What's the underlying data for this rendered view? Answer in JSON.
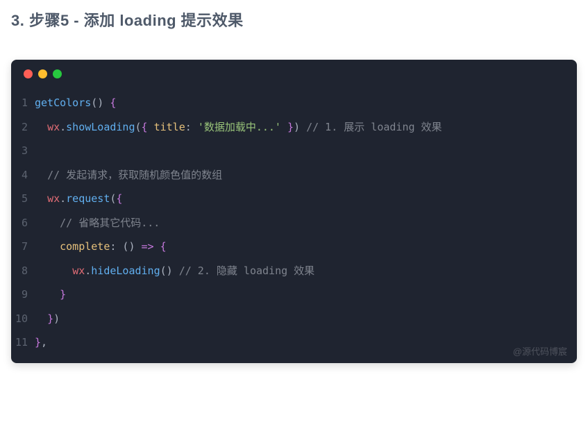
{
  "heading": "3. 步骤5 - 添加 loading 提示效果",
  "traffic_lights": [
    "red",
    "yellow",
    "green"
  ],
  "watermark": "@源代码博宸",
  "code": {
    "lines": [
      {
        "n": "1",
        "t": [
          {
            "c": "tok-fn",
            "s": "getColors"
          },
          {
            "c": "tok-punct",
            "s": "() "
          },
          {
            "c": "tok-brace",
            "s": "{"
          }
        ]
      },
      {
        "n": "2",
        "t": [
          {
            "c": "tok-plain",
            "s": "  "
          },
          {
            "c": "tok-id",
            "s": "wx"
          },
          {
            "c": "tok-punct",
            "s": "."
          },
          {
            "c": "tok-prop",
            "s": "showLoading"
          },
          {
            "c": "tok-punct",
            "s": "("
          },
          {
            "c": "tok-brace",
            "s": "{"
          },
          {
            "c": "tok-plain",
            "s": " "
          },
          {
            "c": "tok-kw",
            "s": "title"
          },
          {
            "c": "tok-punct",
            "s": ": "
          },
          {
            "c": "tok-str",
            "s": "'数据加载中...'"
          },
          {
            "c": "tok-plain",
            "s": " "
          },
          {
            "c": "tok-brace",
            "s": "}"
          },
          {
            "c": "tok-punct",
            "s": ") "
          },
          {
            "c": "tok-cmt",
            "s": "// 1. 展示 loading 效果"
          }
        ]
      },
      {
        "n": "3",
        "t": [
          {
            "c": "tok-plain",
            "s": ""
          }
        ]
      },
      {
        "n": "4",
        "t": [
          {
            "c": "tok-plain",
            "s": "  "
          },
          {
            "c": "tok-cmt",
            "s": "// 发起请求，获取随机颜色值的数组"
          }
        ]
      },
      {
        "n": "5",
        "t": [
          {
            "c": "tok-plain",
            "s": "  "
          },
          {
            "c": "tok-id",
            "s": "wx"
          },
          {
            "c": "tok-punct",
            "s": "."
          },
          {
            "c": "tok-prop",
            "s": "request"
          },
          {
            "c": "tok-punct",
            "s": "("
          },
          {
            "c": "tok-brace",
            "s": "{"
          }
        ]
      },
      {
        "n": "6",
        "t": [
          {
            "c": "tok-plain",
            "s": "    "
          },
          {
            "c": "tok-cmt",
            "s": "// 省略其它代码..."
          }
        ]
      },
      {
        "n": "7",
        "t": [
          {
            "c": "tok-plain",
            "s": "    "
          },
          {
            "c": "tok-kw",
            "s": "complete"
          },
          {
            "c": "tok-punct",
            "s": ": () "
          },
          {
            "c": "tok-arrow",
            "s": "=>"
          },
          {
            "c": "tok-plain",
            "s": " "
          },
          {
            "c": "tok-brace",
            "s": "{"
          }
        ]
      },
      {
        "n": "8",
        "t": [
          {
            "c": "tok-plain",
            "s": "      "
          },
          {
            "c": "tok-id",
            "s": "wx"
          },
          {
            "c": "tok-punct",
            "s": "."
          },
          {
            "c": "tok-prop",
            "s": "hideLoading"
          },
          {
            "c": "tok-punct",
            "s": "() "
          },
          {
            "c": "tok-cmt",
            "s": "// 2. 隐藏 loading 效果"
          }
        ]
      },
      {
        "n": "9",
        "t": [
          {
            "c": "tok-plain",
            "s": "    "
          },
          {
            "c": "tok-brace",
            "s": "}"
          }
        ]
      },
      {
        "n": "10",
        "t": [
          {
            "c": "tok-plain",
            "s": "  "
          },
          {
            "c": "tok-brace",
            "s": "}"
          },
          {
            "c": "tok-punct",
            "s": ")"
          }
        ]
      },
      {
        "n": "11",
        "t": [
          {
            "c": "tok-brace",
            "s": "}"
          },
          {
            "c": "tok-punct",
            "s": ","
          }
        ]
      }
    ]
  }
}
